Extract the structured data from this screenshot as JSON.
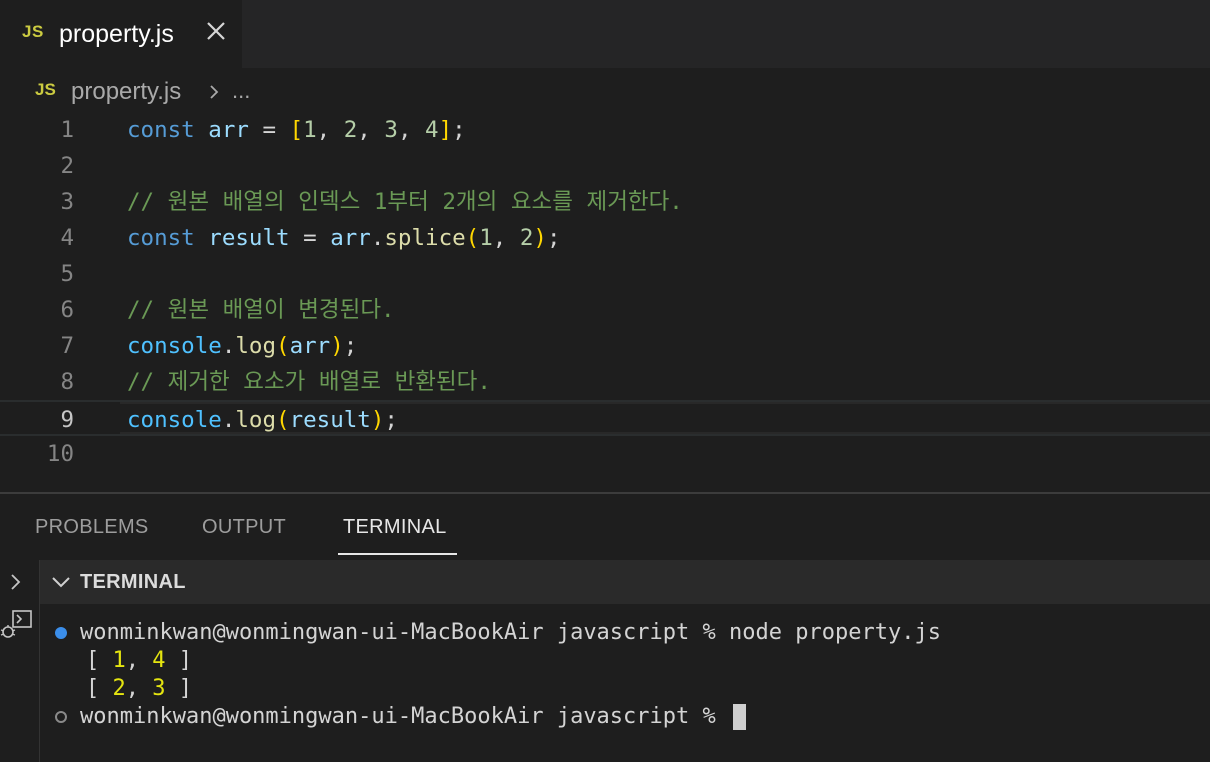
{
  "tab": {
    "icon_text": "JS",
    "label": "property.js",
    "icon": "close-icon"
  },
  "breadcrumb": {
    "icon_text": "JS",
    "file": "property.js",
    "ellipsis": "..."
  },
  "editor": {
    "line_numbers": [
      "1",
      "2",
      "3",
      "4",
      "5",
      "6",
      "7",
      "8",
      "9",
      "10"
    ],
    "active_line": 9,
    "lines": {
      "l1": {
        "kw": "const",
        "var": "arr",
        "eq": " = ",
        "ob": "[",
        "n1": "1",
        "c1": ", ",
        "n2": "2",
        "c2": ", ",
        "n3": "3",
        "c3": ", ",
        "n4": "4",
        "cb": "]",
        "semi": ";"
      },
      "l3": {
        "comment": "// 원본 배열의 인덱스 1부터 2개의 요소를 제거한다."
      },
      "l4": {
        "kw": "const",
        "var": "result",
        "eq": " = ",
        "obj": "arr",
        "dot": ".",
        "fn": "splice",
        "op": "(",
        "n1": "1",
        "c1": ", ",
        "n2": "2",
        "cp": ")",
        "semi": ";"
      },
      "l6": {
        "comment": "// 원본 배열이 변경된다."
      },
      "l7": {
        "obj": "console",
        "dot": ".",
        "fn": "log",
        "op": "(",
        "arg": "arr",
        "cp": ")",
        "semi": ";"
      },
      "l8": {
        "comment": "// 제거한 요소가 배열로 반환된다."
      },
      "l9": {
        "obj": "console",
        "dot": ".",
        "fn": "log",
        "op": "(",
        "arg": "result",
        "cp": ")",
        "semi": ";"
      }
    }
  },
  "panel": {
    "tabs": [
      "PROBLEMS",
      "OUTPUT",
      "TERMINAL"
    ],
    "active_tab": "TERMINAL",
    "terminal_title": "TERMINAL",
    "terminal": {
      "cmd_prompt": "wonminkwan@wonmingwan-ui-MacBookAir javascript % ",
      "cmd": "node property.js",
      "out1": {
        "open": "[ ",
        "a": "1",
        "sep": ", ",
        "b": "4",
        "close": " ]"
      },
      "out2": {
        "open": "[ ",
        "a": "2",
        "sep": ", ",
        "b": "3",
        "close": " ]"
      },
      "prompt2": "wonminkwan@wonmingwan-ui-MacBookAir javascript % "
    }
  },
  "colors": {
    "keyword": "#569cd6",
    "variable": "#9cdcfe",
    "function": "#dcdcaa",
    "number": "#b5cea8",
    "comment": "#6a9955",
    "bracket": "#ffd700",
    "terminal_number": "#e5e510",
    "status_dot": "#3b8eea"
  }
}
